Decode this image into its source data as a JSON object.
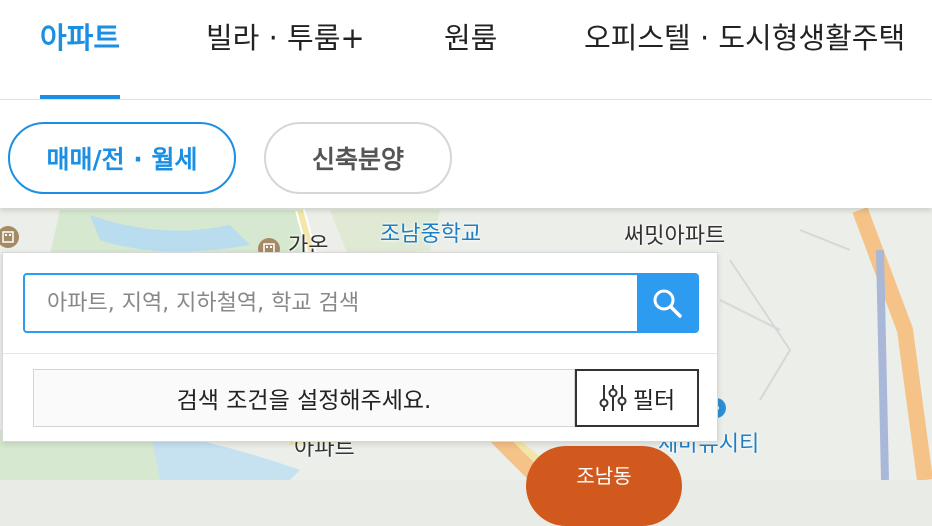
{
  "tabs": [
    {
      "label": "아파트",
      "active": true
    },
    {
      "label": "빌라 · 투룸+",
      "active": false
    },
    {
      "label": "원룸",
      "active": false
    },
    {
      "label": "오피스텔 · 도시형생활주택",
      "active": false
    }
  ],
  "deal_types": [
    {
      "label": "매매/전 · 월세",
      "active": true
    },
    {
      "label": "신축분양",
      "active": false
    }
  ],
  "search": {
    "placeholder": "아파트, 지역, 지하철역, 학교 검색",
    "value": ""
  },
  "conditions": {
    "prompt": "검색 조건을 설정해주세요.",
    "filter_label": "필터"
  },
  "map": {
    "labels": [
      {
        "text": "조남중학교",
        "style": "blue"
      },
      {
        "text": "가온",
        "style": "dark"
      },
      {
        "text": "써밋아파트",
        "style": "dark"
      },
      {
        "text": "아파트",
        "style": "dark"
      },
      {
        "text": "세마뷰시티",
        "style": "blue"
      }
    ],
    "district_marker": "조남동"
  },
  "colors": {
    "accent": "#1a8fe3",
    "search_button": "#2d9bf0",
    "district_marker": "#d2591e",
    "map_road": "#f5c287"
  },
  "icons": {
    "search": "search-icon",
    "filter": "sliders-icon",
    "apartment_poi": "building-icon",
    "school_poi": "school-icon",
    "station_poi": "station-icon"
  }
}
